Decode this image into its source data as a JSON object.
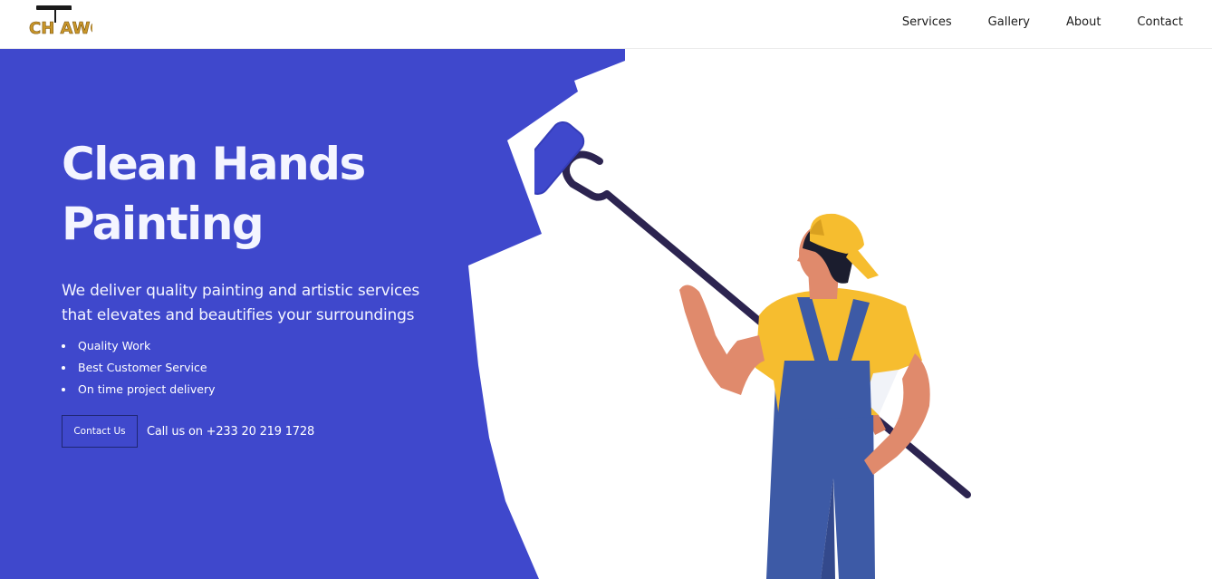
{
  "header": {
    "logo_text": "CH AWC",
    "nav": [
      "Services",
      "Gallery",
      "About",
      "Contact"
    ]
  },
  "hero": {
    "title_line1": "Clean Hands",
    "title_line2": "Painting",
    "subtitle_line1": "We deliver quality painting and artistic services",
    "subtitle_line2": "that elevates and beautifies your surroundings",
    "features": [
      "Quality Work",
      "Best Customer Service",
      "On time project delivery"
    ],
    "contact_button": "Contact Us",
    "call_text": "Call us on +233 20 219 1728"
  },
  "colors": {
    "hero_blue": "#3f48cc",
    "overalls": "#3d5aa6",
    "shirt_yellow": "#f6bd2f",
    "skin": "#e08a6c",
    "roller_handle": "#2c2450"
  },
  "icons": [
    "logo-icon",
    "paint-roller-icon",
    "painter-illustration"
  ]
}
